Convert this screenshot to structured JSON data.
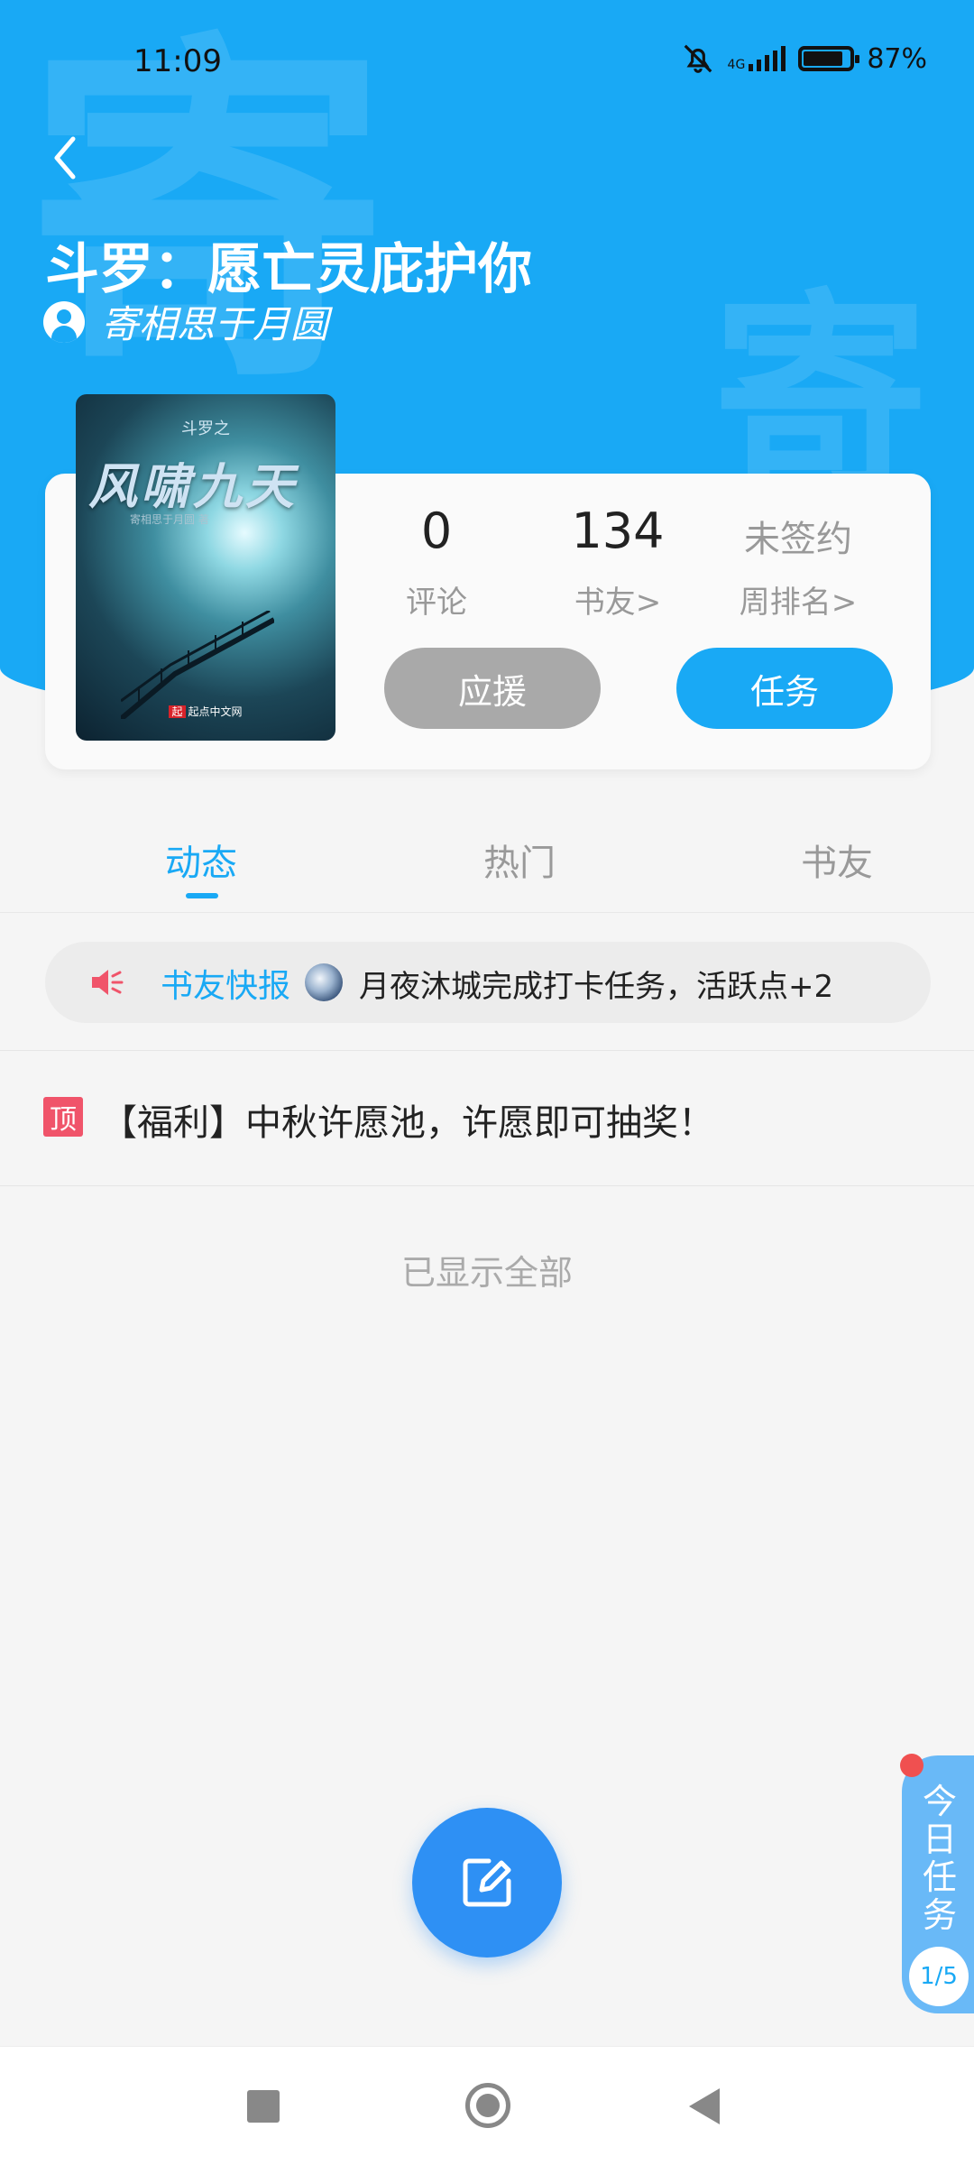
{
  "status_bar": {
    "time": "11:09",
    "network": "4G",
    "battery": "87%",
    "battery_level": 0.87
  },
  "book": {
    "title": "斗罗：愿亡灵庇护你",
    "author": "寄相思于月圆",
    "watermark": "寄",
    "cover": {
      "series": "斗罗之",
      "title": "风啸九天",
      "author": "寄相思于月圆 著",
      "brand": "起点中文网",
      "brand_mark": "起"
    }
  },
  "stats": {
    "comments": {
      "value": "0",
      "label": "评论"
    },
    "fans": {
      "value": "134",
      "label": "书友>"
    },
    "rank": {
      "value": "未签约",
      "label": "周排名>"
    }
  },
  "actions": {
    "support": "应援",
    "task": "任务"
  },
  "tabs": [
    {
      "label": "动态",
      "active": true
    },
    {
      "label": "热门",
      "active": false
    },
    {
      "label": "书友",
      "active": false
    }
  ],
  "ticker": {
    "label": "书友快报",
    "message": "月夜沐城完成打卡任务，活跃点+2"
  },
  "pinned": {
    "badge": "顶",
    "text": "【福利】中秋许愿池，许愿即可抽奖！"
  },
  "footer_text": "已显示全部",
  "daily_task": {
    "label": "今日任务",
    "progress": "1/5"
  },
  "colors": {
    "accent": "#19a9f5",
    "fab": "#2e90f4",
    "support_button": "#a9a9a9",
    "pin_badge": "#f0546a"
  },
  "icons": [
    "back-arrow-icon",
    "mute-bell-icon",
    "signal-icon",
    "battery-icon",
    "user-icon",
    "speaker-icon",
    "edit-icon",
    "nav-recents-icon",
    "nav-home-icon",
    "nav-back-icon"
  ]
}
